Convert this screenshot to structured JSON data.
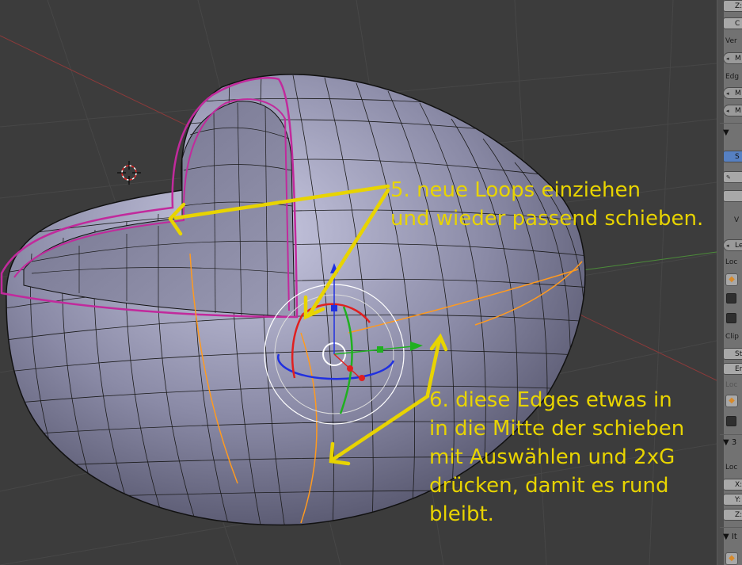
{
  "annotations": {
    "step5": {
      "line1": "5. neue Loops einziehen",
      "line2": "und wieder passend schieben."
    },
    "step6": {
      "line1": "6. diese Edges etwas in",
      "line2": "in die Mitte der schieben",
      "line3": "mit Auswählen und 2xG",
      "line4": "drücken, damit es rund",
      "line5": "bleibt."
    }
  },
  "panel": {
    "z_field": "Z:",
    "btn_top": "C",
    "label_vert": "Ver",
    "btn_m1": "M",
    "label_edge": "Edg",
    "btn_m2": "M",
    "btn_m3": "M",
    "section_toggle": "▼",
    "btn_blue": "S",
    "label_v": "V",
    "btn_le": "Le",
    "label_loc1": "Loc",
    "label_clip": "Clip",
    "btn_st": "St",
    "btn_en": "En",
    "label_loc2": "Loc",
    "section_3": "3",
    "label_loc3": "Loc",
    "axis_x": "X:",
    "axis_y": "Y:",
    "axis_z": "Z:",
    "section_it": "It"
  },
  "colors": {
    "annotation": "#e8d400",
    "selected_edge": "#ff9a1f",
    "boundary_edge": "#c12a9c",
    "gizmo_x": "#e02020",
    "gizmo_y": "#20b020",
    "gizmo_z": "#2030e0"
  }
}
